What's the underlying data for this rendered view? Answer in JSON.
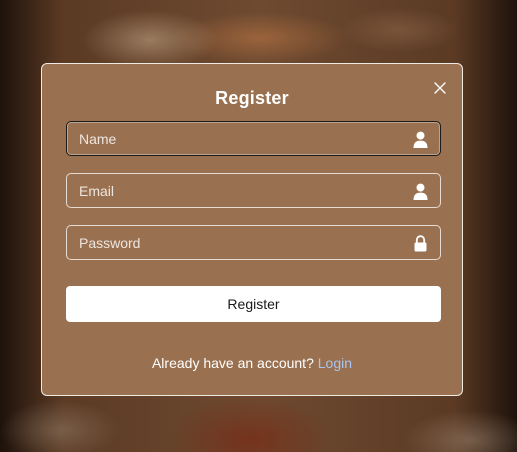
{
  "form": {
    "title": "Register",
    "fields": [
      {
        "placeholder": "Name",
        "value": "",
        "icon": "user-icon"
      },
      {
        "placeholder": "Email",
        "value": "",
        "icon": "user-icon"
      },
      {
        "placeholder": "Password",
        "value": "",
        "icon": "lock-icon"
      }
    ],
    "submit_label": "Register",
    "footer_text": "Already have an account?",
    "login_link": "Login",
    "close_icon": "close-icon"
  },
  "colors": {
    "panel": "#9a7150",
    "link": "#a9c4f0",
    "button": "#ffffff"
  }
}
